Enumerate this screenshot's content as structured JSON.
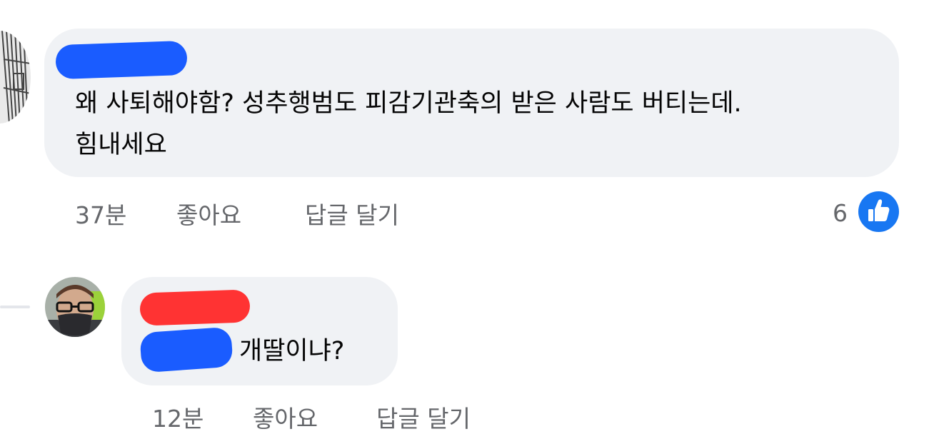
{
  "comments": [
    {
      "text_line1": "왜 사퇴해야함? 성추행범도 피감기관축의 받은 사람도 버티는데.",
      "text_line2": "힘내세요",
      "time": "37분",
      "like_label": "좋아요",
      "reply_label": "답글 달기",
      "reaction_count": "6",
      "reaction_icon": "thumbs-up-icon",
      "reaction_color": "#1877f2"
    },
    {
      "text": "개딸이냐?",
      "time": "12분",
      "like_label": "좋아요",
      "reply_label": "답글 달기"
    }
  ],
  "colors": {
    "bubble": "#f0f2f5",
    "redact_blue": "#1a5cff",
    "redact_red": "#ff3333",
    "meta_text": "#65676b"
  }
}
